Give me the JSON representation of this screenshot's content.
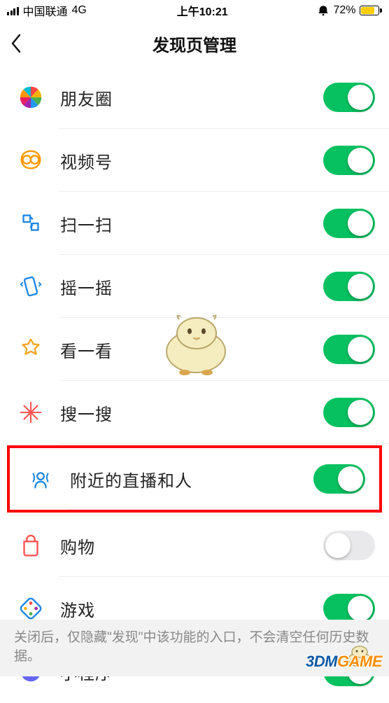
{
  "status": {
    "carrier": "中国联通",
    "network": "4G",
    "time": "上午10:21",
    "battery_pct": "72%"
  },
  "header": {
    "title": "发现页管理"
  },
  "rows": [
    {
      "key": "moments",
      "label": "朋友圈",
      "state": "on"
    },
    {
      "key": "channels",
      "label": "视频号",
      "state": "on"
    },
    {
      "key": "scan",
      "label": "扫一扫",
      "state": "on"
    },
    {
      "key": "shake",
      "label": "摇一摇",
      "state": "on"
    },
    {
      "key": "topstories",
      "label": "看一看",
      "state": "on"
    },
    {
      "key": "search",
      "label": "搜一搜",
      "state": "on"
    },
    {
      "key": "nearby",
      "label": "附近的直播和人",
      "state": "on",
      "highlighted": true
    },
    {
      "key": "shopping",
      "label": "购物",
      "state": "off"
    },
    {
      "key": "games",
      "label": "游戏",
      "state": "on"
    },
    {
      "key": "miniprog",
      "label": "小程序",
      "state": "on"
    }
  ],
  "footer": "关闭后，仅隐藏\"发现\"中该功能的入口，不会清空任何历史数据。",
  "watermark": {
    "prefix": "3DM",
    "suffix": "GAME"
  },
  "colors": {
    "accent": "#07c160",
    "highlight": "#ff0000",
    "battery": "#ffcc00"
  }
}
